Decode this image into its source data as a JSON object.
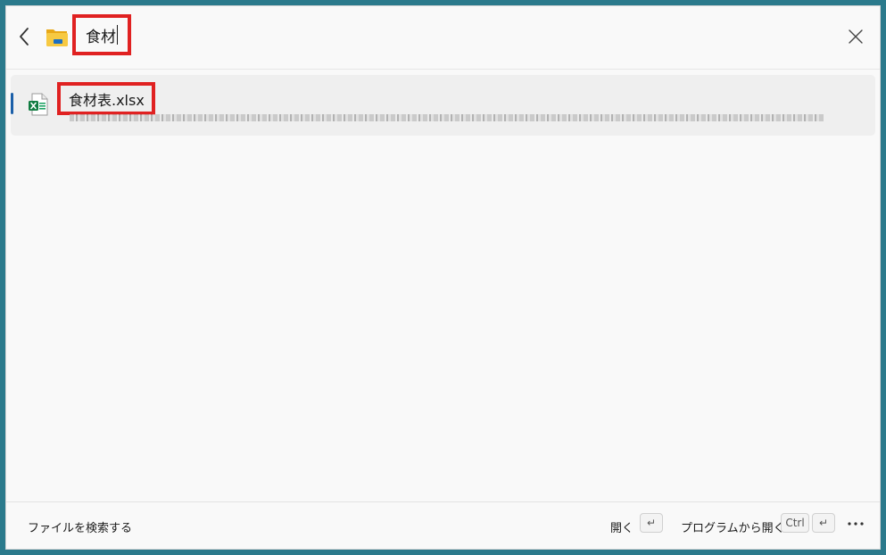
{
  "search": {
    "query": "食材"
  },
  "results": [
    {
      "name": "食材表.xlsx",
      "icon": "excel-file-icon"
    }
  ],
  "footer": {
    "search_files_label": "ファイルを検索する",
    "open_label": "開く",
    "open_key": "↵",
    "open_with_label": "プログラムから開く",
    "open_with_key_ctrl": "Ctrl",
    "open_with_key_enter": "↵",
    "more_icon": "more-icon"
  },
  "colors": {
    "highlight": "#e02121",
    "accent": "#1b5fa8",
    "background": "#2b7a8c"
  }
}
